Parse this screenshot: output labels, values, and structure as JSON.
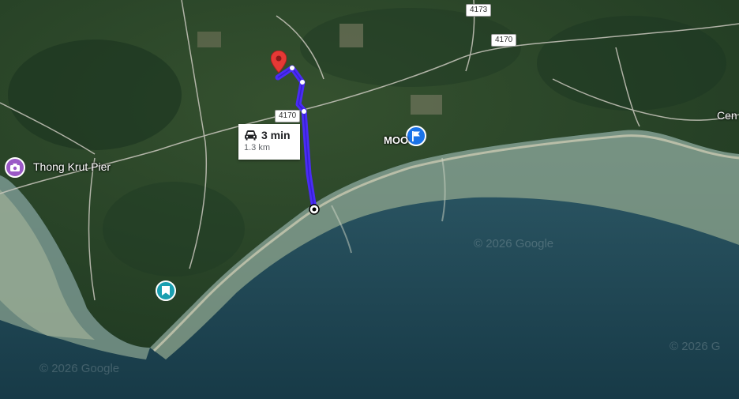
{
  "map": {
    "type": "satellite",
    "colors": {
      "route": "#4a2cf5",
      "pin": "#e53935",
      "poi_camera": "#9b59c7",
      "poi_flag": "#1a73e8",
      "poi_bookmark": "#1a9fb0"
    }
  },
  "roads": {
    "r4173": "4173",
    "r4170_north": "4170",
    "r4170_west": "4170"
  },
  "places": {
    "thong_krut_pier": "Thong Krut Pier",
    "moo": "MOO",
    "cen": "Cen"
  },
  "route": {
    "duration": "3 min",
    "distance": "1.3 km",
    "mode_icon": "car-icon"
  },
  "watermarks": {
    "center": "© 2026 Google",
    "bottom_left": "© 2026 Google",
    "bottom_right": "© 2026 G"
  }
}
